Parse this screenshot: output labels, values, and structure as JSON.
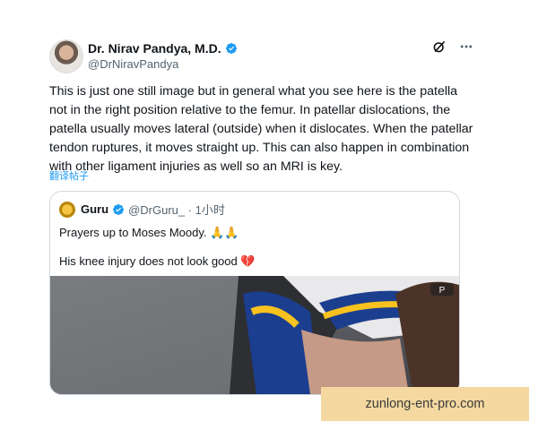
{
  "author": {
    "name": "Dr. Nirav Pandya, M.D.",
    "handle": "@DrNiravPandya",
    "avatar_icon": "profile-photo",
    "verified_color": "#1d9bf0"
  },
  "actions": {
    "grok_icon": "grok-slash-icon",
    "more_icon": "more-dots-icon"
  },
  "tweet": {
    "text": "This is just one still image but in general what you see here is the patella not in the right position relative to the femur. In patellar dislocations, the patella usually moves lateral (outside) when it dislocates.  When the patellar tendon ruptures, it moves straight up.  This can also happen in combination with other ligament injuries as well so an MRI is key.",
    "translate_label": "翻译帖子"
  },
  "quoted": {
    "name": "Guru",
    "handle": "@DrGuru_ · 1小时",
    "line1": "Prayers up to Moses Moody. 🙏🙏",
    "line2": "His knee injury does not look good 💔",
    "media_badge": "P"
  },
  "watermark": {
    "text": "zunlong-ent-pro.com"
  }
}
